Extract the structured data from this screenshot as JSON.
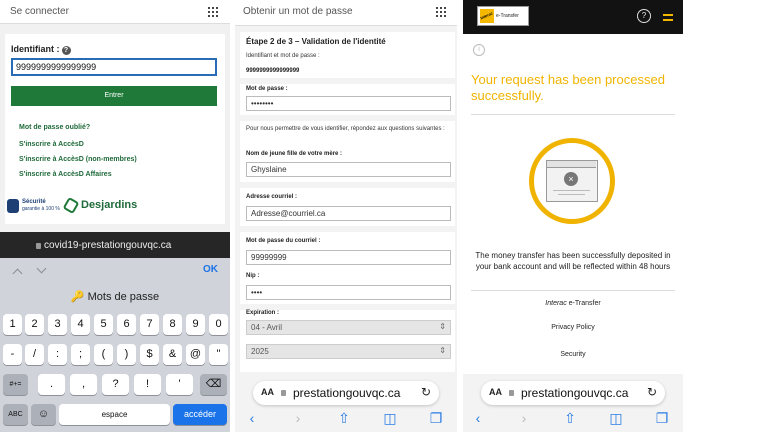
{
  "panel1": {
    "header_title": "Se connecter",
    "field_label": "Identifiant :",
    "help_icon": "help-circle-icon",
    "identifier_value": "9999999999999999",
    "submit_label": "Entrer",
    "links": [
      "Mot de passe oublié?",
      "S'inscrire à AccèsD",
      "S'inscrire à AccèsD (non-membres)",
      "S'inscrire à AccèsD Affaires"
    ],
    "badge_line1": "Sécurité",
    "badge_line2": "garantie à 100 %",
    "brand": "Desjardins",
    "url": "covid19-prestationgouvqc.ca",
    "keyboard": {
      "ok": "OK",
      "field_name": "Mots de passe",
      "row1": [
        "1",
        "2",
        "3",
        "4",
        "5",
        "6",
        "7",
        "8",
        "9",
        "0"
      ],
      "row2": [
        "-",
        "/",
        ":",
        ";",
        "(",
        ")",
        "$",
        "&",
        "@",
        "\""
      ],
      "row3": [
        "#+=",
        ".",
        ",",
        "?",
        "!",
        "'"
      ],
      "row4": [
        "ABC",
        "espace",
        "accéder"
      ]
    }
  },
  "panel2": {
    "header_title": "Obtenir un mot de passe",
    "step_title": "Étape 2 de 3 – Validation de l'identité",
    "id_pw_label": "Identifiant et mot de passe :",
    "id_value": "9999999999999999",
    "password_label": "Mot de passe :",
    "password_value": "••••••••",
    "intro": "Pour nous permettre de vous identifier, répondez aux questions suivantes :",
    "maiden_label": "Nom de jeune fille de votre mère :",
    "maiden_value": "Ghyslaine",
    "email_label": "Adresse courriel :",
    "email_value": "Adresse@courriel.ca",
    "email_pw_label": "Mot de passe du courriel :",
    "email_pw_value": "99999999",
    "pin_label": "Nip :",
    "pin_value": "••••",
    "expiry_label": "Expiration :",
    "expiry_month": "04 - Avril",
    "expiry_year": "2025",
    "url": "prestationgouvqc.ca"
  },
  "panel3": {
    "brand_small": "Interac",
    "brand_name": "e-Transfer",
    "heading": "Your request has been processed successfully.",
    "message": "The money transfer has been successfully deposited in your bank account and will be reflected within 48 hours",
    "link_brand": "Interac",
    "link_brand_rest": " e-Transfer",
    "privacy": "Privacy Policy",
    "security": "Security",
    "url": "prestationgouvqc.ca"
  },
  "safari_aa": "AA",
  "accent_yellow": "#f0b400",
  "accent_green": "#1f7a3a",
  "accent_blue": "#2a7be4"
}
